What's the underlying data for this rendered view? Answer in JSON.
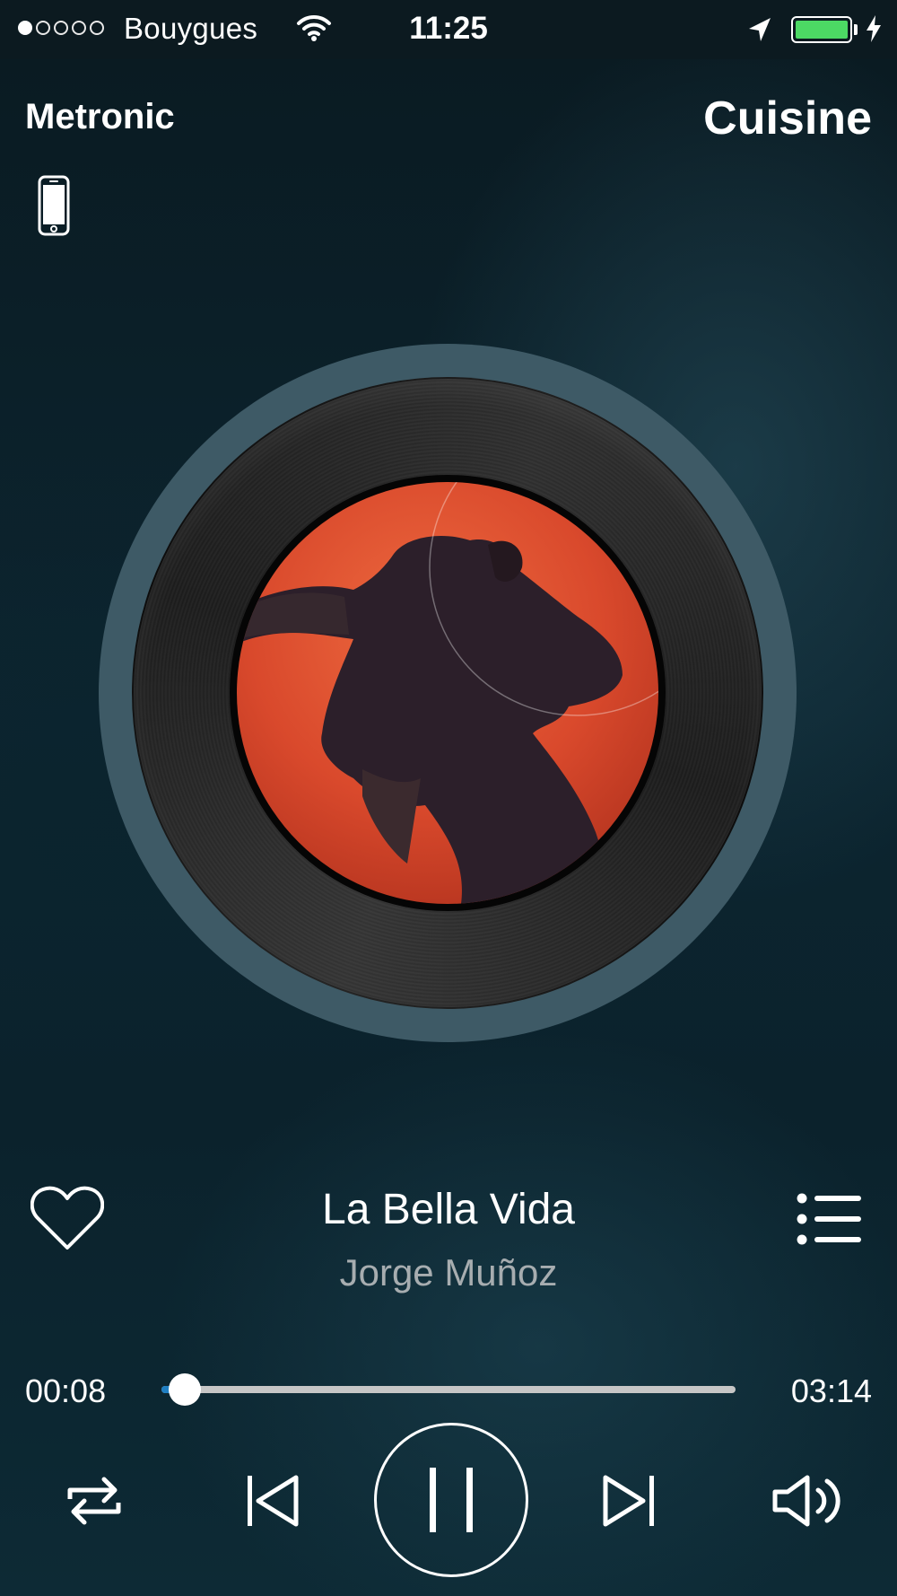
{
  "status_bar": {
    "signal_bars": 5,
    "signal_filled": 1,
    "carrier": "Bouygues",
    "time": "11:25",
    "battery_level": 1.0,
    "battery_color": "#4cd964",
    "icons": [
      "wifi-icon",
      "location-arrow-icon",
      "battery-icon",
      "charging-bolt-icon"
    ]
  },
  "header": {
    "left_title": "Metronic",
    "right_title": "Cuisine",
    "device_icon": "phone-icon"
  },
  "track": {
    "title": "La Bella Vida",
    "artist": "Jorge Muñoz",
    "artwork_icon": "album-cover-vinyl"
  },
  "progress": {
    "elapsed": "00:08",
    "total": "03:14",
    "fraction": 0.041,
    "fill_color": "#1f7fc2",
    "track_color": "#c6c6c6"
  },
  "controls": {
    "icons": [
      "heart-icon",
      "queue-list-icon",
      "repeat-icon",
      "previous-icon",
      "pause-icon",
      "next-icon",
      "volume-icon"
    ]
  }
}
